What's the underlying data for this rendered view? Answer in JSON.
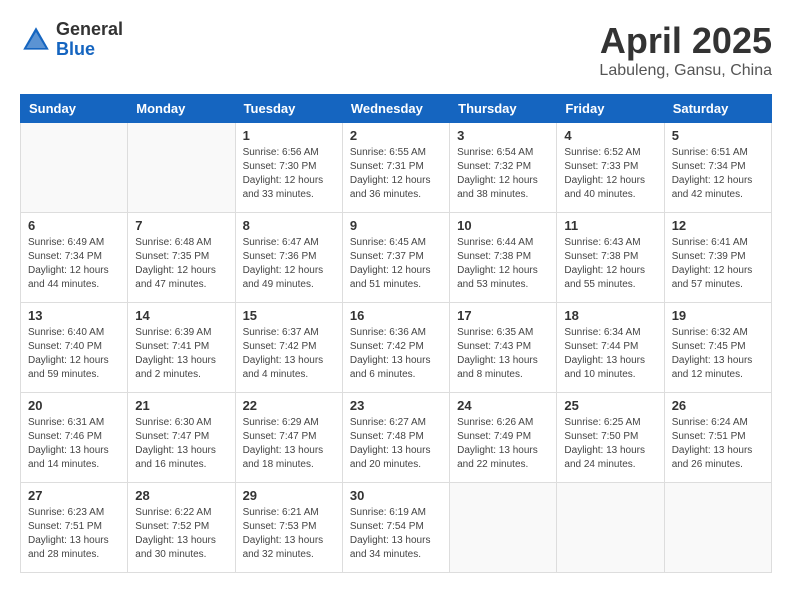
{
  "logo": {
    "general": "General",
    "blue": "Blue"
  },
  "title": "April 2025",
  "location": "Labuleng, Gansu, China",
  "days_of_week": [
    "Sunday",
    "Monday",
    "Tuesday",
    "Wednesday",
    "Thursday",
    "Friday",
    "Saturday"
  ],
  "weeks": [
    [
      {
        "day": "",
        "info": ""
      },
      {
        "day": "",
        "info": ""
      },
      {
        "day": "1",
        "info": "Sunrise: 6:56 AM\nSunset: 7:30 PM\nDaylight: 12 hours\nand 33 minutes."
      },
      {
        "day": "2",
        "info": "Sunrise: 6:55 AM\nSunset: 7:31 PM\nDaylight: 12 hours\nand 36 minutes."
      },
      {
        "day": "3",
        "info": "Sunrise: 6:54 AM\nSunset: 7:32 PM\nDaylight: 12 hours\nand 38 minutes."
      },
      {
        "day": "4",
        "info": "Sunrise: 6:52 AM\nSunset: 7:33 PM\nDaylight: 12 hours\nand 40 minutes."
      },
      {
        "day": "5",
        "info": "Sunrise: 6:51 AM\nSunset: 7:34 PM\nDaylight: 12 hours\nand 42 minutes."
      }
    ],
    [
      {
        "day": "6",
        "info": "Sunrise: 6:49 AM\nSunset: 7:34 PM\nDaylight: 12 hours\nand 44 minutes."
      },
      {
        "day": "7",
        "info": "Sunrise: 6:48 AM\nSunset: 7:35 PM\nDaylight: 12 hours\nand 47 minutes."
      },
      {
        "day": "8",
        "info": "Sunrise: 6:47 AM\nSunset: 7:36 PM\nDaylight: 12 hours\nand 49 minutes."
      },
      {
        "day": "9",
        "info": "Sunrise: 6:45 AM\nSunset: 7:37 PM\nDaylight: 12 hours\nand 51 minutes."
      },
      {
        "day": "10",
        "info": "Sunrise: 6:44 AM\nSunset: 7:38 PM\nDaylight: 12 hours\nand 53 minutes."
      },
      {
        "day": "11",
        "info": "Sunrise: 6:43 AM\nSunset: 7:38 PM\nDaylight: 12 hours\nand 55 minutes."
      },
      {
        "day": "12",
        "info": "Sunrise: 6:41 AM\nSunset: 7:39 PM\nDaylight: 12 hours\nand 57 minutes."
      }
    ],
    [
      {
        "day": "13",
        "info": "Sunrise: 6:40 AM\nSunset: 7:40 PM\nDaylight: 12 hours\nand 59 minutes."
      },
      {
        "day": "14",
        "info": "Sunrise: 6:39 AM\nSunset: 7:41 PM\nDaylight: 13 hours\nand 2 minutes."
      },
      {
        "day": "15",
        "info": "Sunrise: 6:37 AM\nSunset: 7:42 PM\nDaylight: 13 hours\nand 4 minutes."
      },
      {
        "day": "16",
        "info": "Sunrise: 6:36 AM\nSunset: 7:42 PM\nDaylight: 13 hours\nand 6 minutes."
      },
      {
        "day": "17",
        "info": "Sunrise: 6:35 AM\nSunset: 7:43 PM\nDaylight: 13 hours\nand 8 minutes."
      },
      {
        "day": "18",
        "info": "Sunrise: 6:34 AM\nSunset: 7:44 PM\nDaylight: 13 hours\nand 10 minutes."
      },
      {
        "day": "19",
        "info": "Sunrise: 6:32 AM\nSunset: 7:45 PM\nDaylight: 13 hours\nand 12 minutes."
      }
    ],
    [
      {
        "day": "20",
        "info": "Sunrise: 6:31 AM\nSunset: 7:46 PM\nDaylight: 13 hours\nand 14 minutes."
      },
      {
        "day": "21",
        "info": "Sunrise: 6:30 AM\nSunset: 7:47 PM\nDaylight: 13 hours\nand 16 minutes."
      },
      {
        "day": "22",
        "info": "Sunrise: 6:29 AM\nSunset: 7:47 PM\nDaylight: 13 hours\nand 18 minutes."
      },
      {
        "day": "23",
        "info": "Sunrise: 6:27 AM\nSunset: 7:48 PM\nDaylight: 13 hours\nand 20 minutes."
      },
      {
        "day": "24",
        "info": "Sunrise: 6:26 AM\nSunset: 7:49 PM\nDaylight: 13 hours\nand 22 minutes."
      },
      {
        "day": "25",
        "info": "Sunrise: 6:25 AM\nSunset: 7:50 PM\nDaylight: 13 hours\nand 24 minutes."
      },
      {
        "day": "26",
        "info": "Sunrise: 6:24 AM\nSunset: 7:51 PM\nDaylight: 13 hours\nand 26 minutes."
      }
    ],
    [
      {
        "day": "27",
        "info": "Sunrise: 6:23 AM\nSunset: 7:51 PM\nDaylight: 13 hours\nand 28 minutes."
      },
      {
        "day": "28",
        "info": "Sunrise: 6:22 AM\nSunset: 7:52 PM\nDaylight: 13 hours\nand 30 minutes."
      },
      {
        "day": "29",
        "info": "Sunrise: 6:21 AM\nSunset: 7:53 PM\nDaylight: 13 hours\nand 32 minutes."
      },
      {
        "day": "30",
        "info": "Sunrise: 6:19 AM\nSunset: 7:54 PM\nDaylight: 13 hours\nand 34 minutes."
      },
      {
        "day": "",
        "info": ""
      },
      {
        "day": "",
        "info": ""
      },
      {
        "day": "",
        "info": ""
      }
    ]
  ]
}
